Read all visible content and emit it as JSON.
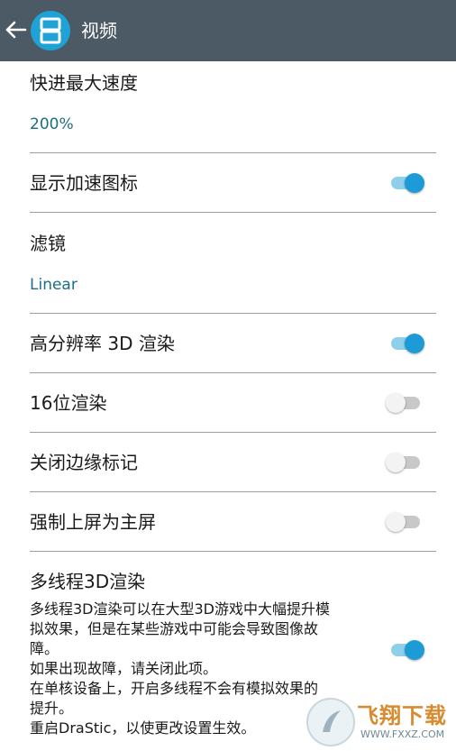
{
  "appbar": {
    "title": "视频",
    "background": "#4b5a64",
    "logo_color": "#1fa3d6",
    "icons": {
      "back": "back-arrow-icon",
      "logo": "drastic-logo-icon"
    }
  },
  "accent": "#1d9bd6",
  "settings": {
    "fast_forward": {
      "title": "快进最大速度",
      "value": "200%"
    },
    "show_speed_icon": {
      "title": "显示加速图标",
      "enabled": true
    },
    "filter": {
      "title": "滤镜",
      "value": "Linear"
    },
    "hires_3d": {
      "title": "高分辨率 3D 渲染",
      "enabled": true
    },
    "render_16bit": {
      "title": "16位渲染",
      "enabled": false
    },
    "disable_edge_mark": {
      "title": "关闭边缘标记",
      "enabled": false
    },
    "force_top_screen": {
      "title": "强制上屏为主屏",
      "enabled": false
    },
    "multithread_3d": {
      "title": "多线程3D渲染",
      "description": [
        "多线程3D渲染可以在大型3D游戏中大幅提升模",
        "拟效果，但是在某些游戏中可能会导致图像故",
        "障。",
        "如果出现故障，请关闭此项。",
        "在单核设备上，开启多线程不会有模拟效果的",
        "提升。",
        "重启DraStic，以使更改设置生效。"
      ],
      "enabled": true
    }
  },
  "watermark": {
    "text": "飞翔下载",
    "url": "WWW.FXXZ.COM"
  }
}
